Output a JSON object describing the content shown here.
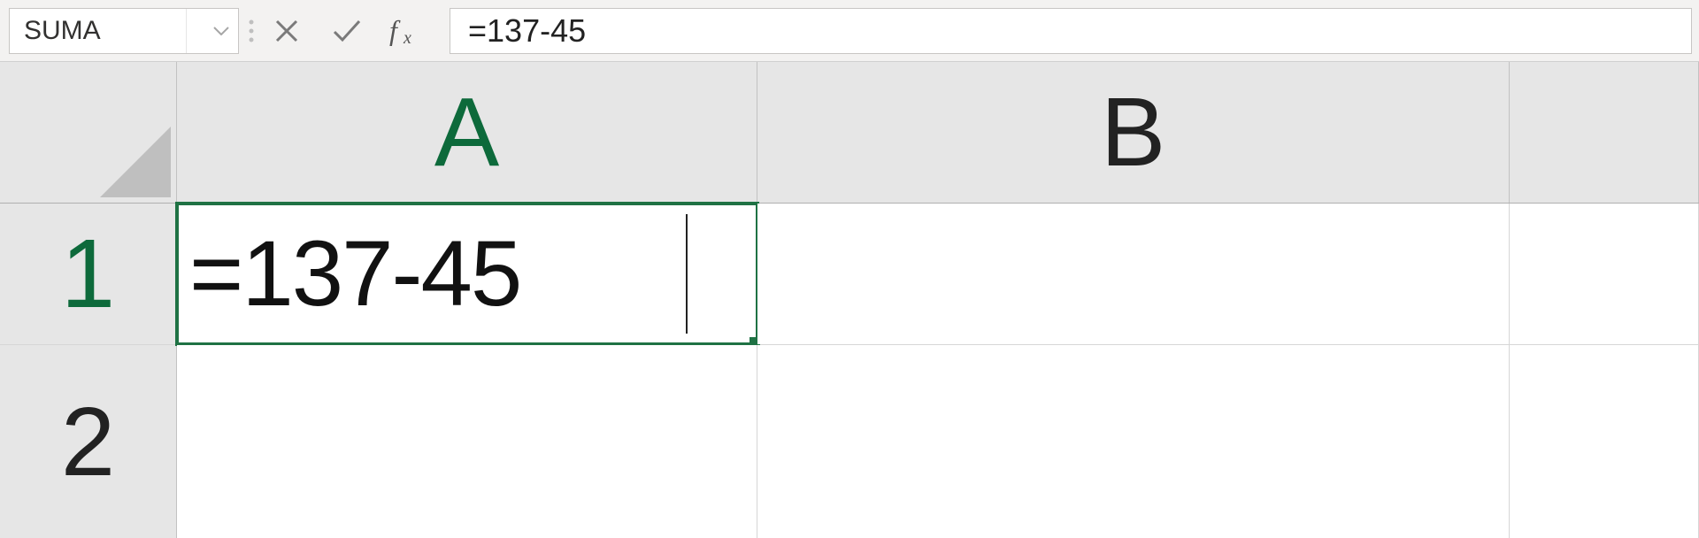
{
  "formulaBar": {
    "nameBox": "SUMA",
    "formula": "=137-45"
  },
  "columns": [
    "A",
    "B"
  ],
  "rows": [
    "1",
    "2"
  ],
  "cells": {
    "A1": "=137-45"
  }
}
